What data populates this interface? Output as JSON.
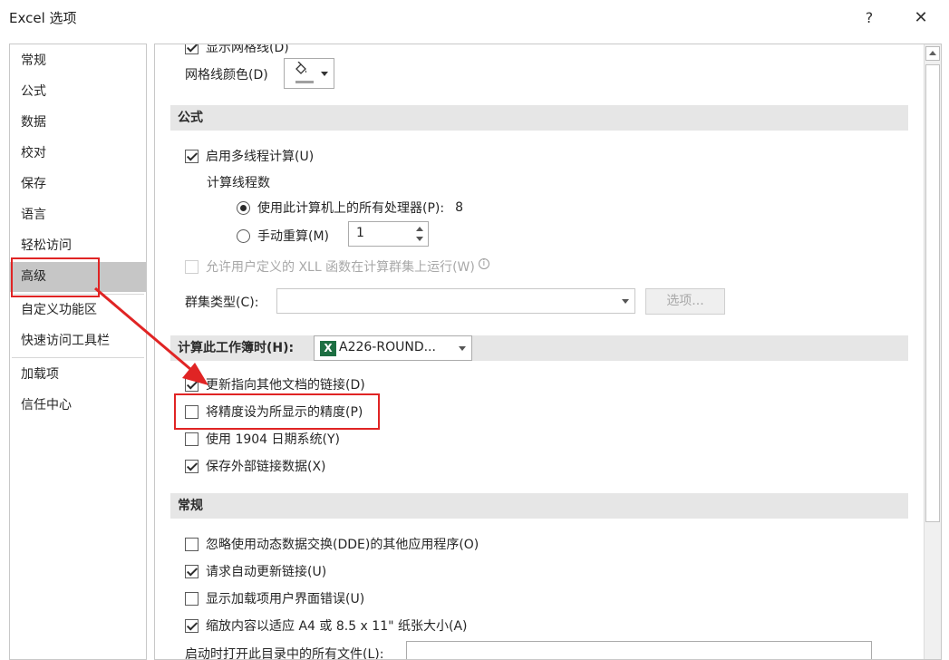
{
  "window": {
    "title": "Excel 选项",
    "help": "?",
    "close": "✕"
  },
  "sidebar": {
    "items": [
      {
        "label": "常规"
      },
      {
        "label": "公式"
      },
      {
        "label": "数据"
      },
      {
        "label": "校对"
      },
      {
        "label": "保存"
      },
      {
        "label": "语言"
      },
      {
        "label": "轻松访问"
      },
      {
        "label": "高级",
        "selected": true
      },
      {
        "label": "自定义功能区"
      },
      {
        "label": "快速访问工具栏"
      },
      {
        "label": "加载项"
      },
      {
        "label": "信任中心"
      }
    ]
  },
  "content": {
    "partial_top_label": "显示网格线(D)",
    "gridline_color_label": "网格线颜色(D)",
    "sections": {
      "formulas": "公式",
      "workbook": "计算此工作簿时(H):",
      "general": "常规"
    },
    "multithread": {
      "label": "启用多线程计算(U)",
      "checked": true
    },
    "threads_group_label": "计算线程数",
    "use_all_processors": {
      "label": "使用此计算机上的所有处理器(P):",
      "value": "8",
      "selected": true
    },
    "manual_threads": {
      "label": "手动重算(M)",
      "value": "1",
      "selected": false
    },
    "xll": {
      "label": "允许用户定义的 XLL 函数在计算群集上运行(W)",
      "checked": false,
      "disabled": true,
      "info_icon": "i"
    },
    "cluster_type_label": "群集类型(C):",
    "cluster_options_btn": "选项...",
    "workbook_select": {
      "value": "A226-ROUND...",
      "icon_letter": "X"
    },
    "options": [
      {
        "label": "更新指向其他文档的链接(D)",
        "checked": true
      },
      {
        "label": "将精度设为所显示的精度(P)",
        "checked": false
      },
      {
        "label": "使用 1904 日期系统(Y)",
        "checked": false
      },
      {
        "label": "保存外部链接数据(X)",
        "checked": true
      }
    ],
    "general_options": [
      {
        "label": "忽略使用动态数据交换(DDE)的其他应用程序(O)",
        "checked": false
      },
      {
        "label": "请求自动更新链接(U)",
        "checked": true
      },
      {
        "label": "显示加载项用户界面错误(U)",
        "checked": false
      },
      {
        "label": "缩放内容以适应 A4 或 8.5 x 11\" 纸张大小(A)",
        "checked": true
      }
    ],
    "partial_bottom_label": "启动时打开此目录中的所有文件(L):"
  },
  "annotation": {
    "color": "#e02424"
  }
}
